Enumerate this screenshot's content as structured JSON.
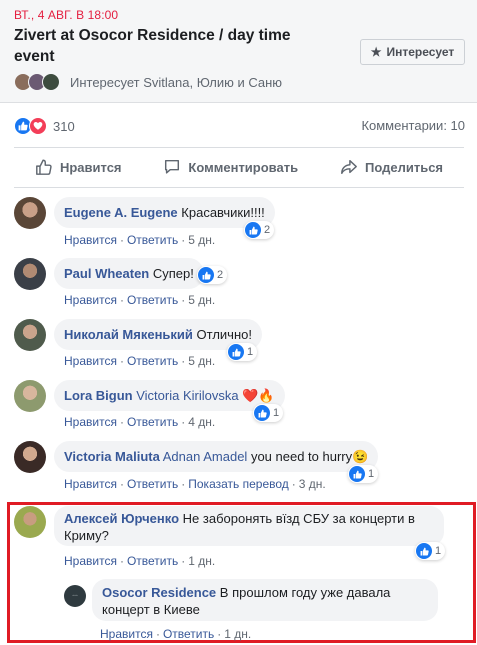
{
  "event": {
    "date": "ВТ., 4 АВГ. В 18:00",
    "title": "Zivert at Osocor Residence / day time event",
    "interest_button": "Интересует",
    "interest_icon": "star-icon",
    "friends_text": "Интересует Svitlana, Юлию и Саню"
  },
  "reactions": {
    "count": "310",
    "comments_label": "Комментарии: 10"
  },
  "actions": {
    "like": "Нравится",
    "comment": "Комментировать",
    "share": "Поделиться"
  },
  "comments": [
    {
      "author": "Eugene A. Eugene",
      "mention": "",
      "text": "Красавчики!!!!",
      "like": "Нравится",
      "reply": "Ответить",
      "extra": "",
      "time": "5 дн.",
      "likes": "2"
    },
    {
      "author": "Paul Wheaten",
      "mention": "",
      "text": "Супер!",
      "like": "Нравится",
      "reply": "Ответить",
      "extra": "",
      "time": "5 дн.",
      "likes": "2"
    },
    {
      "author": "Николай Мякенький",
      "mention": "",
      "text": "Отлично!",
      "like": "Нравится",
      "reply": "Ответить",
      "extra": "",
      "time": "5 дн.",
      "likes": "1"
    },
    {
      "author": "Lora Bigun",
      "mention": "Victoria Kirilovska",
      "text": "❤️🔥",
      "like": "Нравится",
      "reply": "Ответить",
      "extra": "",
      "time": "4 дн.",
      "likes": "1"
    },
    {
      "author": "Victoria Maliuta",
      "mention": "Adnan Amadel",
      "text": "you need to hurry😉",
      "like": "Нравится",
      "reply": "Ответить",
      "extra": "Показать перевод",
      "time": "3 дн.",
      "likes": "1"
    },
    {
      "author": "Алексей Юрченко",
      "mention": "",
      "text": "Не заборонять вїзд СБУ за концерти в Криму?",
      "like": "Нравится",
      "reply": "Ответить",
      "extra": "",
      "time": "1 дн.",
      "likes": "1"
    }
  ],
  "reply": {
    "author": "Osocor Residence",
    "text": "В прошлом году уже давала концерт в Киеве",
    "like": "Нравится",
    "reply": "Ответить",
    "time": "1 дн."
  },
  "colors": {
    "accent_blue": "#1877f2",
    "link_blue": "#385898",
    "date_red": "#e41e3f",
    "highlight_red": "#e01b24"
  }
}
